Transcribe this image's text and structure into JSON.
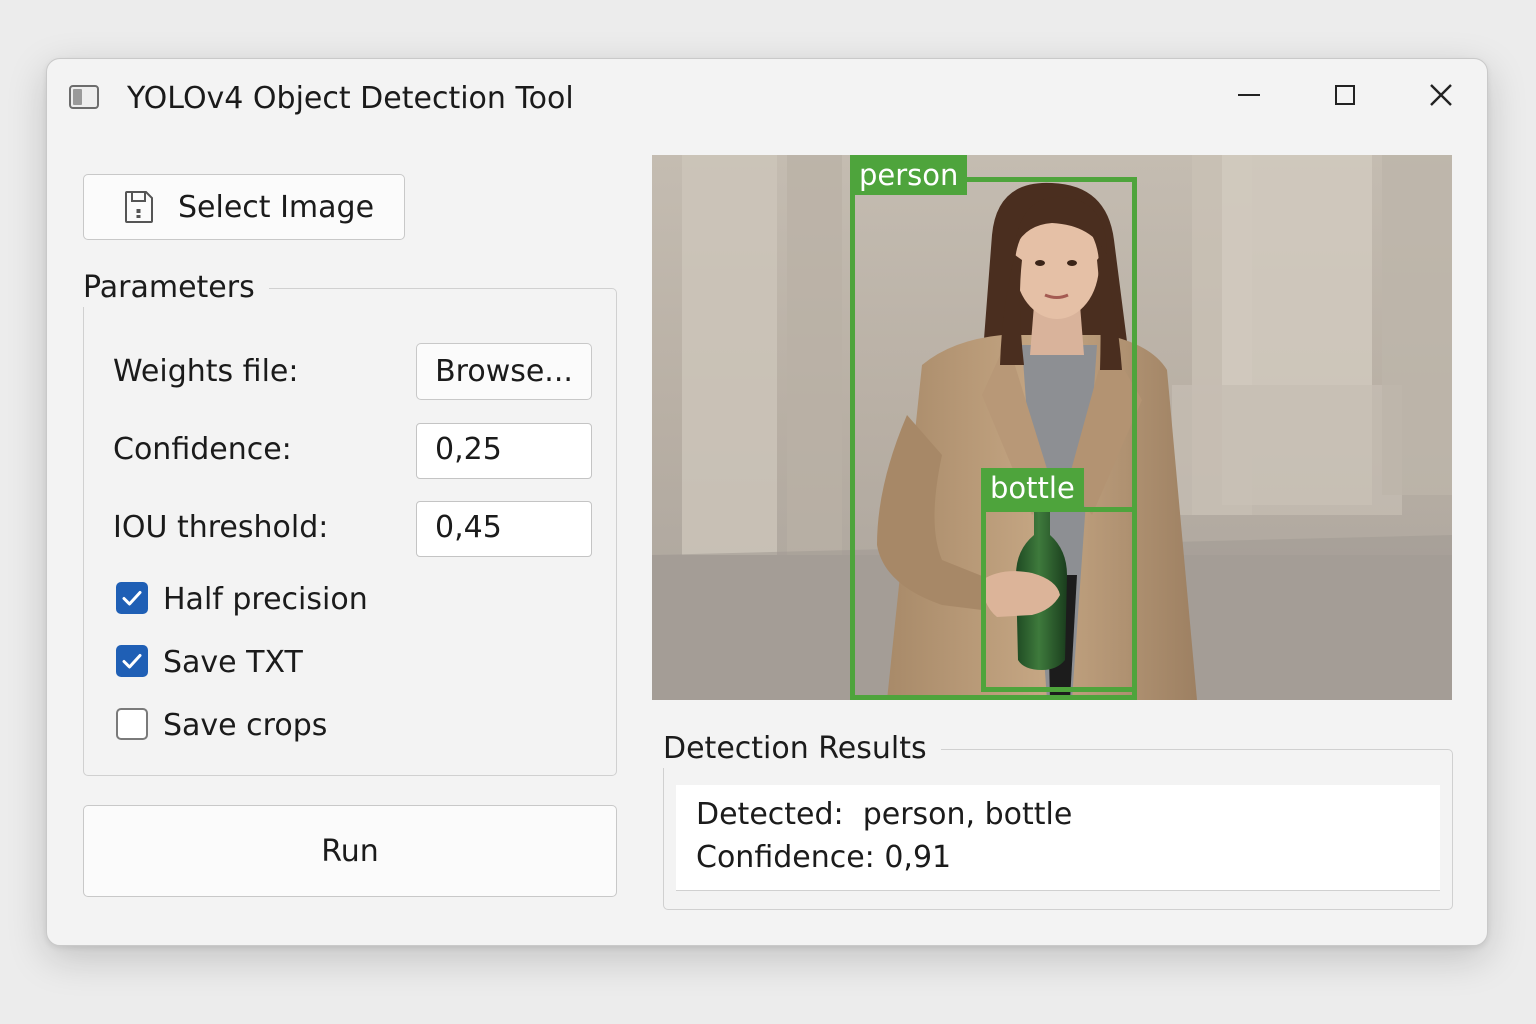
{
  "window": {
    "title": "YOLOv4 Object Detection Tool",
    "icon": "app-window-icon",
    "controls": [
      "minimize-icon",
      "maximize-icon",
      "close-icon"
    ]
  },
  "toolbar": {
    "select_image_label": "Select Image",
    "select_image_icon": "save-disk-icon"
  },
  "parameters": {
    "title": "Parameters",
    "weights_label": "Weights file:",
    "browse_label": "Browse...",
    "confidence_label": "Confidence:",
    "confidence_value": "0,25",
    "iou_label": "IOU threshold:",
    "iou_value": "0,45",
    "checkboxes": [
      {
        "label": "Half precision",
        "checked": true
      },
      {
        "label": "Save TXT",
        "checked": true
      },
      {
        "label": "Save crops",
        "checked": false
      }
    ]
  },
  "run_label": "Run",
  "preview": {
    "detections": [
      {
        "label": "person"
      },
      {
        "label": "bottle"
      }
    ],
    "box_color": "#4ea43c"
  },
  "results": {
    "title": "Detection Results",
    "detected_line": "Detected:  person, bottle",
    "confidence_line": "Confidence: 0,91"
  },
  "colors": {
    "accent": "#1f5fb5",
    "detection": "#4ea43c",
    "window_bg": "#f3f3f3"
  }
}
